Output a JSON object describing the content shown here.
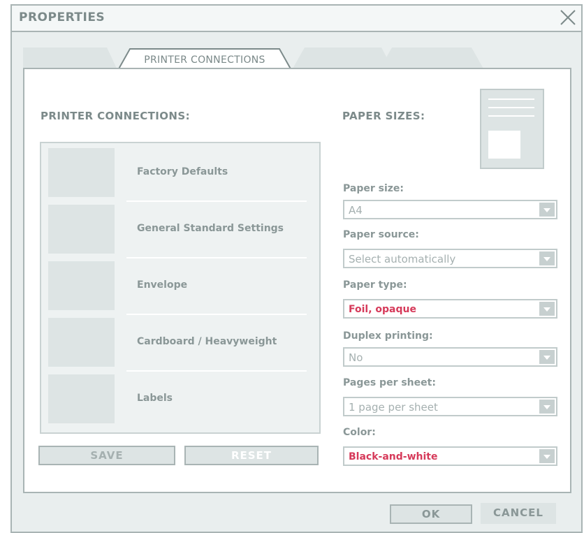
{
  "window": {
    "title": "PROPERTIES"
  },
  "tabs": [
    {
      "label": ""
    },
    {
      "label": "PRINTER CONNECTIONS",
      "active": true
    },
    {
      "label": ""
    },
    {
      "label": ""
    }
  ],
  "printer_connections": {
    "heading": "PRINTER CONNECTIONS:",
    "items": [
      {
        "label": "Factory Defaults"
      },
      {
        "label": "General Standard Settings"
      },
      {
        "label": "Envelope"
      },
      {
        "label": "Cardboard / Heavyweight"
      },
      {
        "label": "Labels"
      }
    ],
    "save_label": "SAVE",
    "reset_label": "RESET"
  },
  "paper_sizes": {
    "heading": "PAPER SIZES:",
    "fields": [
      {
        "label": "Paper size:",
        "value": "A4",
        "highlight": false
      },
      {
        "label": "Paper source:",
        "value": "Select automatically",
        "highlight": false
      },
      {
        "label": "Paper type:",
        "value": "Foil, opaque",
        "highlight": true
      },
      {
        "label": "Duplex printing:",
        "value": "No",
        "highlight": false
      },
      {
        "label": "Pages per sheet:",
        "value": "1 page per sheet",
        "highlight": false
      },
      {
        "label": "Color:",
        "value": "Black-and-white",
        "highlight": true
      }
    ]
  },
  "footer": {
    "ok_label": "OK",
    "cancel_label": "CANCEL"
  },
  "colors": {
    "highlight": "#d63a5a",
    "frame": "#a9b4b4",
    "background": "#e9eeee"
  }
}
